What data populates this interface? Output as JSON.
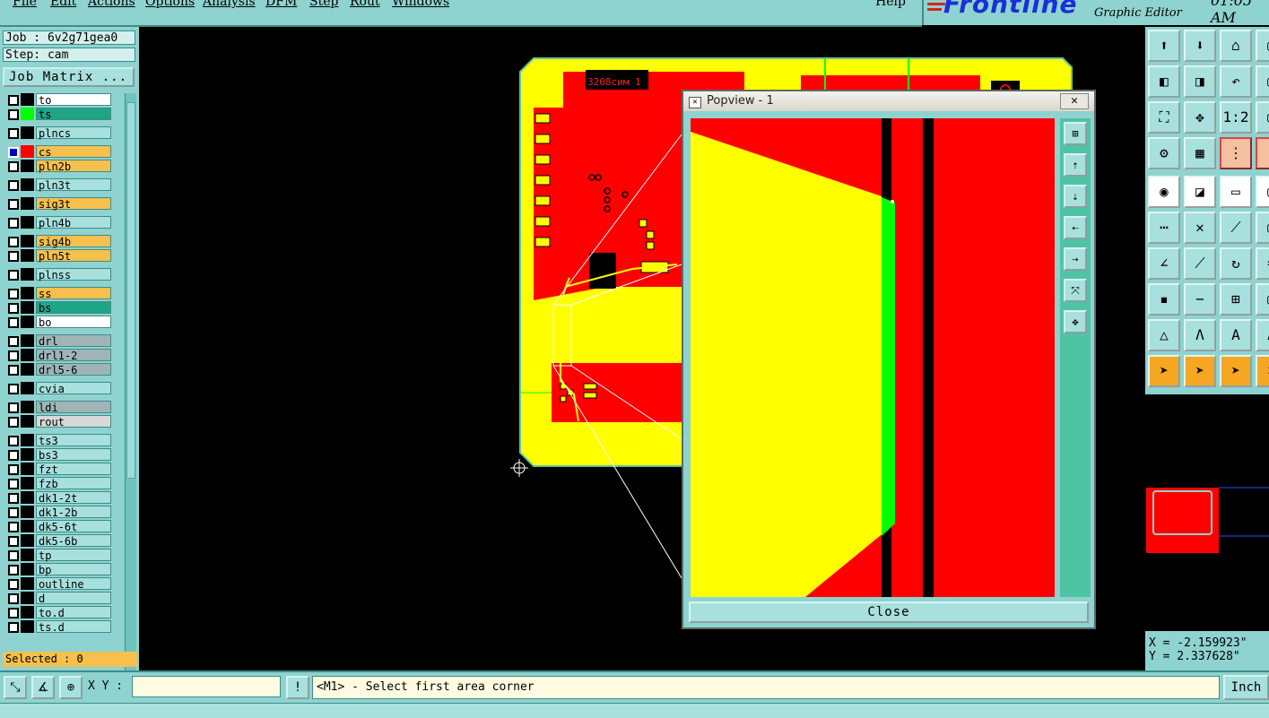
{
  "menu": [
    "File",
    "Edit",
    "Actions",
    "Options",
    "Analysis",
    "DFM",
    "Step",
    "Rout",
    "Windows"
  ],
  "help": "Help",
  "brand": {
    "logo": "Frontline",
    "subtitle": "Graphic Editor",
    "clock": "01:05 AM"
  },
  "job": {
    "job_label": "Job : 6v2g71gea0",
    "step_label": "Step: cam",
    "matrix_button": "Job Matrix ..."
  },
  "layers": [
    {
      "name": "to",
      "color": "#ffffff",
      "swatch": "#000000"
    },
    {
      "name": "ts",
      "color": "#1fa585",
      "swatch": "#00ff00"
    },
    {
      "name": "plncs",
      "color": "#a8e0dd",
      "swatch": "#000000"
    },
    {
      "name": "cs",
      "color": "#f5c04d",
      "swatch": "#ff0000",
      "active": true
    },
    {
      "name": "pln2b",
      "color": "#f5c04d",
      "swatch": "#000000"
    },
    {
      "name": "pln3t",
      "color": "#a8e0dd",
      "swatch": "#000000"
    },
    {
      "name": "sig3t",
      "color": "#f5c04d",
      "swatch": "#000000"
    },
    {
      "name": "pln4b",
      "color": "#a8e0dd",
      "swatch": "#000000"
    },
    {
      "name": "sig4b",
      "color": "#f5c04d",
      "swatch": "#000000"
    },
    {
      "name": "pln5t",
      "color": "#f5c04d",
      "swatch": "#000000"
    },
    {
      "name": "plnss",
      "color": "#a8e0dd",
      "swatch": "#000000"
    },
    {
      "name": "ss",
      "color": "#f5c04d",
      "swatch": "#000000"
    },
    {
      "name": "bs",
      "color": "#1fa585",
      "swatch": "#000000"
    },
    {
      "name": "bo",
      "color": "#ffffff",
      "swatch": "#000000"
    },
    {
      "name": "drl",
      "color": "#a0b4b8",
      "swatch": "#000000"
    },
    {
      "name": "drl1-2",
      "color": "#a0b4b8",
      "swatch": "#000000"
    },
    {
      "name": "drl5-6",
      "color": "#a0b4b8",
      "swatch": "#000000"
    },
    {
      "name": "cvia",
      "color": "#a8e0dd",
      "swatch": "#000000"
    },
    {
      "name": "ldi",
      "color": "#a0b4b8",
      "swatch": "#000000"
    },
    {
      "name": "rout",
      "color": "#d8d8d8",
      "swatch": "#000000"
    },
    {
      "name": "ts3",
      "color": "#a8e0dd",
      "swatch": "#000000"
    },
    {
      "name": "bs3",
      "color": "#a8e0dd",
      "swatch": "#000000"
    },
    {
      "name": "fzt",
      "color": "#a8e0dd",
      "swatch": "#000000"
    },
    {
      "name": "fzb",
      "color": "#a8e0dd",
      "swatch": "#000000"
    },
    {
      "name": "dk1-2t",
      "color": "#a8e0dd",
      "swatch": "#000000"
    },
    {
      "name": "dk1-2b",
      "color": "#a8e0dd",
      "swatch": "#000000"
    },
    {
      "name": "dk5-6t",
      "color": "#a8e0dd",
      "swatch": "#000000"
    },
    {
      "name": "dk5-6b",
      "color": "#a8e0dd",
      "swatch": "#000000"
    },
    {
      "name": "tp",
      "color": "#a8e0dd",
      "swatch": "#000000"
    },
    {
      "name": "bp",
      "color": "#a8e0dd",
      "swatch": "#000000"
    },
    {
      "name": "outline",
      "color": "#a8e0dd",
      "swatch": "#000000"
    },
    {
      "name": "d",
      "color": "#a8e0dd",
      "swatch": "#000000"
    },
    {
      "name": "to.d",
      "color": "#a8e0dd",
      "swatch": "#000000"
    },
    {
      "name": "ts.d",
      "color": "#a8e0dd",
      "swatch": "#000000"
    }
  ],
  "selected": "Selected : 0",
  "board": {
    "silk_text": "3208сим 1"
  },
  "popview": {
    "title": "Popview - 1",
    "close_label": "Close"
  },
  "coords": {
    "x": "X = -2.159923\"",
    "y": "Y = 2.337628\""
  },
  "status": {
    "xy_label": "X Y :",
    "xy_value": "",
    "prompt": "<M1> - Select first area corner",
    "unit": "Inch"
  },
  "colors": {
    "panel": "#8ed3cf",
    "board": "#ffff00",
    "copper": "#ff0000",
    "accent_green": "#00ff00"
  }
}
